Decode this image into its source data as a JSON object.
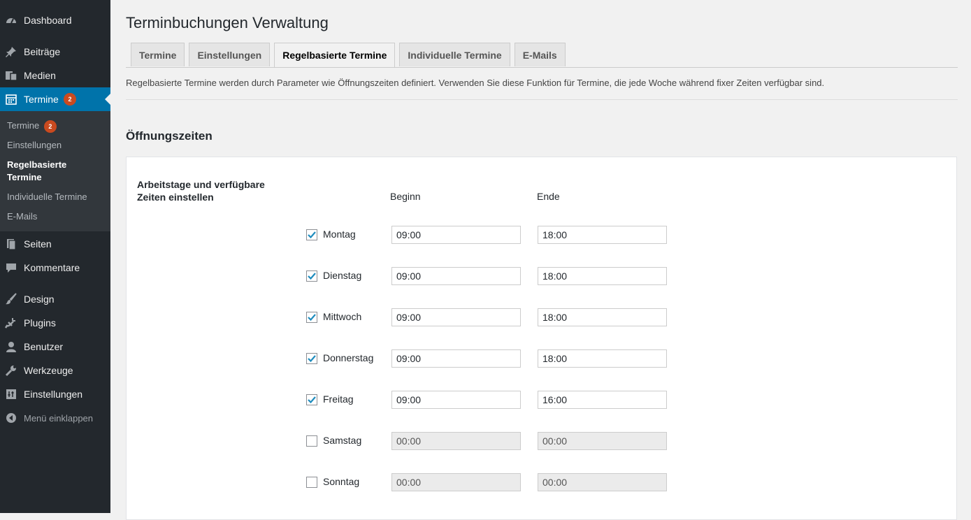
{
  "sidebar": {
    "items": [
      {
        "icon": "dashboard-icon",
        "label": "Dashboard"
      },
      {
        "icon": "pin-icon",
        "label": "Beiträge"
      },
      {
        "icon": "media-icon",
        "label": "Medien"
      },
      {
        "icon": "calendar-icon",
        "label": "Termine",
        "badge": "2"
      },
      {
        "icon": "pages-icon",
        "label": "Seiten"
      },
      {
        "icon": "comment-icon",
        "label": "Kommentare"
      },
      {
        "icon": "brush-icon",
        "label": "Design"
      },
      {
        "icon": "plugin-icon",
        "label": "Plugins"
      },
      {
        "icon": "user-icon",
        "label": "Benutzer"
      },
      {
        "icon": "wrench-icon",
        "label": "Werkzeuge"
      },
      {
        "icon": "settings-icon",
        "label": "Einstellungen"
      },
      {
        "icon": "collapse-icon",
        "label": "Menü einklappen"
      }
    ],
    "submenu": [
      {
        "label": "Termine",
        "badge": "2"
      },
      {
        "label": "Einstellungen"
      },
      {
        "label": "Regelbasierte Termine"
      },
      {
        "label": "Individuelle Termine"
      },
      {
        "label": "E-Mails"
      }
    ]
  },
  "page": {
    "title": "Terminbuchungen Verwaltung",
    "tabs": [
      "Termine",
      "Einstellungen",
      "Regelbasierte Termine",
      "Individuelle Termine",
      "E-Mails"
    ],
    "description": "Regelbasierte Termine werden durch Parameter wie Öffnungszeiten definiert. Verwenden Sie diese Funktion für Termine, die jede Woche während fixer Zeiten verfügbar sind.",
    "section_title": "Öffnungszeiten",
    "card_label": "Arbeitstage und verfügbare Zeiten einstellen",
    "col_begin": "Beginn",
    "col_end": "Ende",
    "days": [
      {
        "name": "Montag",
        "checked": true,
        "begin": "09:00",
        "end": "18:00"
      },
      {
        "name": "Dienstag",
        "checked": true,
        "begin": "09:00",
        "end": "18:00"
      },
      {
        "name": "Mittwoch",
        "checked": true,
        "begin": "09:00",
        "end": "18:00"
      },
      {
        "name": "Donnerstag",
        "checked": true,
        "begin": "09:00",
        "end": "18:00"
      },
      {
        "name": "Freitag",
        "checked": true,
        "begin": "09:00",
        "end": "16:00"
      },
      {
        "name": "Samstag",
        "checked": false,
        "begin": "00:00",
        "end": "00:00"
      },
      {
        "name": "Sonntag",
        "checked": false,
        "begin": "00:00",
        "end": "00:00"
      }
    ]
  },
  "colors": {
    "sidebar_bg": "#23282d",
    "active_blue": "#0073aa",
    "badge_red": "#ca4a1f",
    "check_blue": "#1e8cbe"
  }
}
